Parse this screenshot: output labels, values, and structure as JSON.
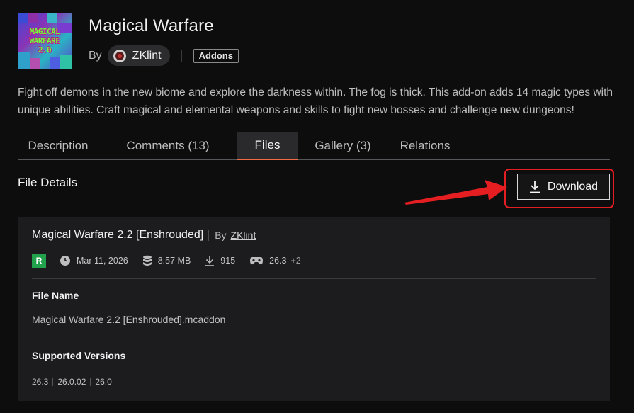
{
  "header": {
    "logo_text_1": "MAGICAL",
    "logo_text_2": "WARFARE",
    "logo_text_3": "2.0",
    "title": "Magical Warfare",
    "by_label": "By",
    "author": "ZKlint",
    "category": "Addons"
  },
  "summary": "Fight off demons in the new biome and explore the darkness within. The fog is thick. This add-on adds 14 magic types with unique abilities. Craft magical and elemental weapons and skills to fight new bosses and challenge new dungeons!",
  "tabs": [
    {
      "label": "Description"
    },
    {
      "label": "Comments (13)"
    },
    {
      "label": "Files"
    },
    {
      "label": "Gallery (3)"
    },
    {
      "label": "Relations"
    }
  ],
  "active_tab": "Files",
  "file_details_title": "File Details",
  "download_label": "Download",
  "file": {
    "title": "Magical Warfare 2.2 [Enshrouded]",
    "by_label": "By",
    "author": "ZKlint",
    "release_badge": "R",
    "date": "Mar 11, 2026",
    "size": "8.57 MB",
    "downloads": "915",
    "game_version": "26.3",
    "game_version_extra": "+2",
    "file_name_label": "File Name",
    "file_name": "Magical Warfare 2.2 [Enshrouded].mcaddon",
    "supported_versions_label": "Supported Versions",
    "supported_versions": [
      "26.3",
      "26.0.02",
      "26.0"
    ]
  },
  "colors": {
    "accent_tab_underline": "#f26b42",
    "release_badge": "#23a24d",
    "highlight": "#e51e22"
  },
  "icons": {
    "date": "clock-icon",
    "size": "database-icon",
    "downloads": "download-icon",
    "game_version": "gamepad-icon"
  }
}
